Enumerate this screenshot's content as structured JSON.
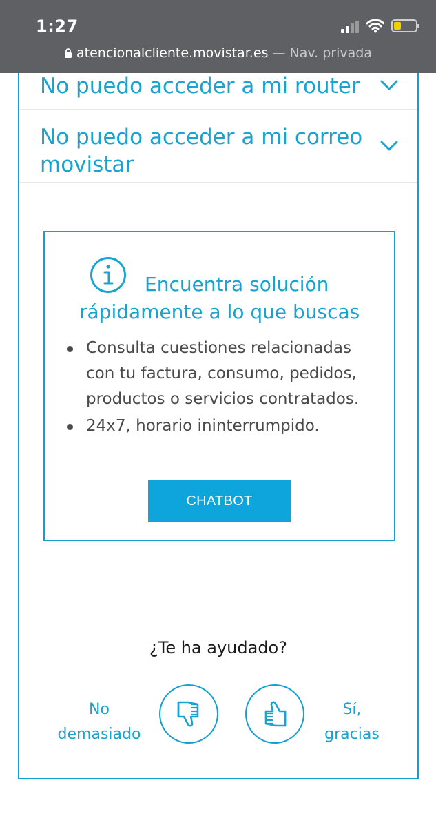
{
  "status_bar": {
    "time": "1:27",
    "url": "atencionalcliente.movistar.es",
    "separator": "—",
    "private_label": "Nav. privada",
    "icons": [
      "signal-icon",
      "wifi-icon",
      "battery-icon",
      "lock-icon"
    ]
  },
  "accordion": {
    "items": [
      {
        "label": "No puedo acceder a mi router"
      },
      {
        "label": "No puedo acceder a mi correo movistar"
      }
    ]
  },
  "card": {
    "title_line1": "Encuentra solución",
    "title_line2": "rápidamente a lo que buscas",
    "bullets": [
      "Consulta cuestiones relacionadas con tu factura, consumo, pedidos, productos o servicios contratados.",
      "24x7, horario ininterrumpido."
    ],
    "button_label": "CHATBOT",
    "icon": "info-icon"
  },
  "feedback": {
    "question": "¿Te ha ayudado?",
    "no_label": "No demasiado",
    "yes_label": "Sí, gracias",
    "icons": [
      "thumbs-down-icon",
      "thumbs-up-icon"
    ]
  },
  "colors": {
    "accent": "#19a3d0",
    "button": "#0ea5dc",
    "topbar": "#5f6063",
    "border": "#13a0d0",
    "battery": "#f2d000"
  }
}
